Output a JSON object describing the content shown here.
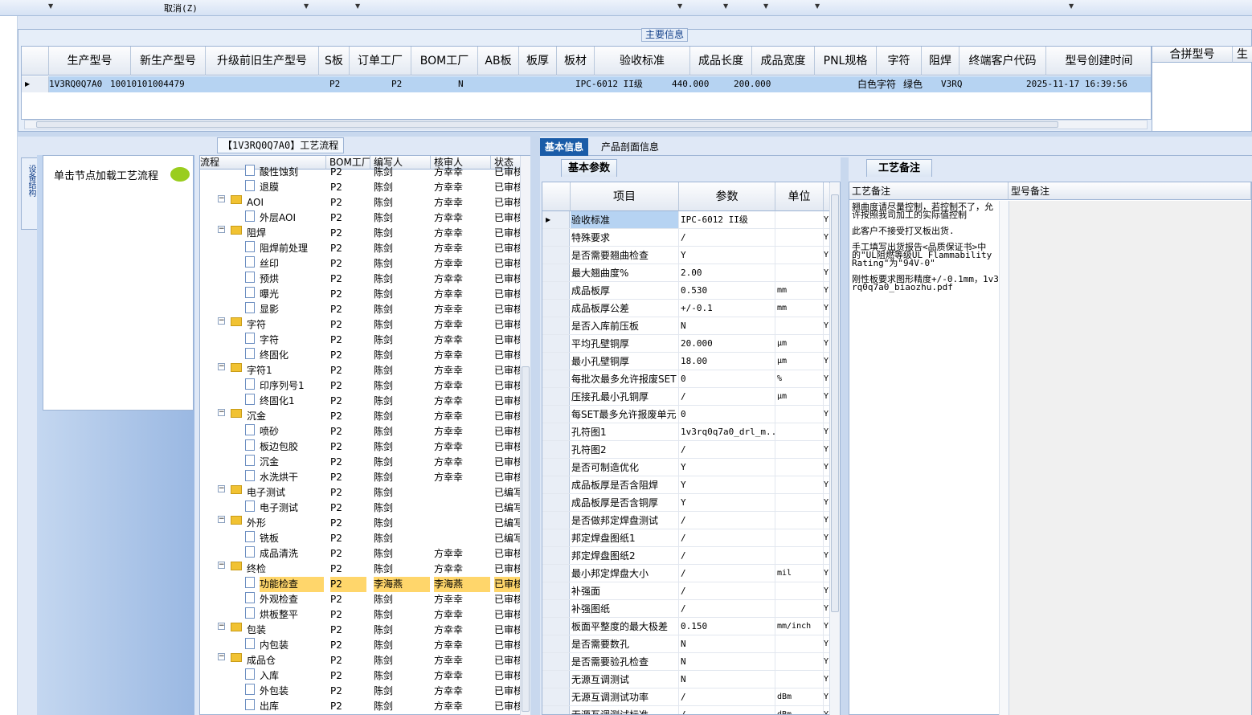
{
  "toolbar": {
    "cancel_label": "取消(Z)"
  },
  "main_info": {
    "legend": "主要信息",
    "columns": [
      "生产型号",
      "新生产型号",
      "升级前旧生产型号",
      "S板",
      "订单工厂",
      "BOM工厂",
      "AB板",
      "板厚",
      "板材",
      "验收标准",
      "成品长度",
      "成品宽度",
      "PNL规格",
      "字符",
      "阻焊",
      "终端客户代码",
      "型号创建时间"
    ],
    "row": {
      "prod_model": "1V3RQ0Q7A0",
      "new_prod_model": "10010101004479",
      "old_model": "",
      "s_board": "",
      "order_factory": "P2",
      "bom_factory": "P2",
      "ab_board": "N",
      "thickness": "",
      "material": "",
      "standard": "IPC-6012 II级",
      "length": "440.000",
      "width": "200.000",
      "pnl": "",
      "char": "白色字符",
      "mask": "绿色",
      "customer_code": "V3RQ",
      "created": "2025-11-17 16:39:56"
    },
    "merge_headers": [
      "合拼型号",
      "生"
    ]
  },
  "left_panel": {
    "side_tab": "设备结构",
    "load_hint": "单击节点加载工艺流程"
  },
  "process": {
    "tab_title": "【1V3RQ0Q7A0】工艺流程",
    "headers": [
      "流程",
      "BOM工厂",
      "编写人",
      "核审人",
      "状态"
    ],
    "rows": [
      {
        "lvl": 2,
        "type": "leaf",
        "name": "酸性蚀刻",
        "bom": "P2",
        "writer": "陈剑",
        "reviewer": "方幸幸",
        "status": "已审核"
      },
      {
        "lvl": 2,
        "type": "leaf",
        "name": "退膜",
        "bom": "P2",
        "writer": "陈剑",
        "reviewer": "方幸幸",
        "status": "已审核"
      },
      {
        "lvl": 1,
        "type": "folder",
        "name": "AOI",
        "bom": "P2",
        "writer": "陈剑",
        "reviewer": "方幸幸",
        "status": "已审核"
      },
      {
        "lvl": 2,
        "type": "leaf",
        "name": "外层AOI",
        "bom": "P2",
        "writer": "陈剑",
        "reviewer": "方幸幸",
        "status": "已审核"
      },
      {
        "lvl": 1,
        "type": "folder",
        "name": "阻焊",
        "bom": "P2",
        "writer": "陈剑",
        "reviewer": "方幸幸",
        "status": "已审核"
      },
      {
        "lvl": 2,
        "type": "leaf",
        "name": "阻焊前处理",
        "bom": "P2",
        "writer": "陈剑",
        "reviewer": "方幸幸",
        "status": "已审核"
      },
      {
        "lvl": 2,
        "type": "leaf",
        "name": "丝印",
        "bom": "P2",
        "writer": "陈剑",
        "reviewer": "方幸幸",
        "status": "已审核"
      },
      {
        "lvl": 2,
        "type": "leaf",
        "name": "预烘",
        "bom": "P2",
        "writer": "陈剑",
        "reviewer": "方幸幸",
        "status": "已审核"
      },
      {
        "lvl": 2,
        "type": "leaf",
        "name": "曝光",
        "bom": "P2",
        "writer": "陈剑",
        "reviewer": "方幸幸",
        "status": "已审核"
      },
      {
        "lvl": 2,
        "type": "leaf",
        "name": "显影",
        "bom": "P2",
        "writer": "陈剑",
        "reviewer": "方幸幸",
        "status": "已审核"
      },
      {
        "lvl": 1,
        "type": "folder",
        "name": "字符",
        "bom": "P2",
        "writer": "陈剑",
        "reviewer": "方幸幸",
        "status": "已审核"
      },
      {
        "lvl": 2,
        "type": "leaf",
        "name": "字符",
        "bom": "P2",
        "writer": "陈剑",
        "reviewer": "方幸幸",
        "status": "已审核"
      },
      {
        "lvl": 2,
        "type": "leaf",
        "name": "终固化",
        "bom": "P2",
        "writer": "陈剑",
        "reviewer": "方幸幸",
        "status": "已审核"
      },
      {
        "lvl": 1,
        "type": "folder",
        "name": "字符1",
        "bom": "P2",
        "writer": "陈剑",
        "reviewer": "方幸幸",
        "status": "已审核"
      },
      {
        "lvl": 2,
        "type": "leaf",
        "name": "印序列号1",
        "bom": "P2",
        "writer": "陈剑",
        "reviewer": "方幸幸",
        "status": "已审核"
      },
      {
        "lvl": 2,
        "type": "leaf",
        "name": "终固化1",
        "bom": "P2",
        "writer": "陈剑",
        "reviewer": "方幸幸",
        "status": "已审核"
      },
      {
        "lvl": 1,
        "type": "folder",
        "name": "沉金",
        "bom": "P2",
        "writer": "陈剑",
        "reviewer": "方幸幸",
        "status": "已审核"
      },
      {
        "lvl": 2,
        "type": "leaf",
        "name": "喷砂",
        "bom": "P2",
        "writer": "陈剑",
        "reviewer": "方幸幸",
        "status": "已审核"
      },
      {
        "lvl": 2,
        "type": "leaf",
        "name": "板边包胶",
        "bom": "P2",
        "writer": "陈剑",
        "reviewer": "方幸幸",
        "status": "已审核"
      },
      {
        "lvl": 2,
        "type": "leaf",
        "name": "沉金",
        "bom": "P2",
        "writer": "陈剑",
        "reviewer": "方幸幸",
        "status": "已审核"
      },
      {
        "lvl": 2,
        "type": "leaf",
        "name": "水洗烘干",
        "bom": "P2",
        "writer": "陈剑",
        "reviewer": "方幸幸",
        "status": "已审核"
      },
      {
        "lvl": 1,
        "type": "folder",
        "name": "电子测试",
        "bom": "P2",
        "writer": "陈剑",
        "reviewer": "",
        "status": "已编写"
      },
      {
        "lvl": 2,
        "type": "leaf",
        "name": "电子测试",
        "bom": "P2",
        "writer": "陈剑",
        "reviewer": "",
        "status": "已编写"
      },
      {
        "lvl": 1,
        "type": "folder",
        "name": "外形",
        "bom": "P2",
        "writer": "陈剑",
        "reviewer": "",
        "status": "已编写"
      },
      {
        "lvl": 2,
        "type": "leaf",
        "name": "铣板",
        "bom": "P2",
        "writer": "陈剑",
        "reviewer": "",
        "status": "已编写"
      },
      {
        "lvl": 2,
        "type": "leaf",
        "name": "成品清洗",
        "bom": "P2",
        "writer": "陈剑",
        "reviewer": "方幸幸",
        "status": "已审核"
      },
      {
        "lvl": 1,
        "type": "folder",
        "name": "终检",
        "bom": "P2",
        "writer": "陈剑",
        "reviewer": "方幸幸",
        "status": "已审核"
      },
      {
        "lvl": 2,
        "type": "leaf",
        "name": "功能检查",
        "bom": "P2",
        "writer": "李海燕",
        "reviewer": "李海燕",
        "status": "已审核",
        "selected": true
      },
      {
        "lvl": 2,
        "type": "leaf",
        "name": "外观检查",
        "bom": "P2",
        "writer": "陈剑",
        "reviewer": "方幸幸",
        "status": "已审核"
      },
      {
        "lvl": 2,
        "type": "leaf",
        "name": "烘板整平",
        "bom": "P2",
        "writer": "陈剑",
        "reviewer": "方幸幸",
        "status": "已审核"
      },
      {
        "lvl": 1,
        "type": "folder",
        "name": "包装",
        "bom": "P2",
        "writer": "陈剑",
        "reviewer": "方幸幸",
        "status": "已审核"
      },
      {
        "lvl": 2,
        "type": "leaf",
        "name": "内包装",
        "bom": "P2",
        "writer": "陈剑",
        "reviewer": "方幸幸",
        "status": "已审核"
      },
      {
        "lvl": 1,
        "type": "folder",
        "name": "成品仓",
        "bom": "P2",
        "writer": "陈剑",
        "reviewer": "方幸幸",
        "status": "已审核"
      },
      {
        "lvl": 2,
        "type": "leaf",
        "name": "入库",
        "bom": "P2",
        "writer": "陈剑",
        "reviewer": "方幸幸",
        "status": "已审核"
      },
      {
        "lvl": 2,
        "type": "leaf",
        "name": "外包装",
        "bom": "P2",
        "writer": "陈剑",
        "reviewer": "方幸幸",
        "status": "已审核"
      },
      {
        "lvl": 2,
        "type": "leaf",
        "name": "出库",
        "bom": "P2",
        "writer": "陈剑",
        "reviewer": "方幸幸",
        "status": "已审核"
      }
    ]
  },
  "right_tabs": [
    "基本信息",
    "产品剖面信息"
  ],
  "basic": {
    "tab": "基本参数",
    "headers": [
      "项目",
      "参数",
      "单位"
    ],
    "rows": [
      [
        "验收标准",
        "IPC-6012 II级",
        "",
        "Y"
      ],
      [
        "特殊要求",
        "/",
        "",
        "Y"
      ],
      [
        "是否需要翘曲检查",
        "Y",
        "",
        "Y"
      ],
      [
        "最大翘曲度%",
        "2.00",
        "",
        "Y"
      ],
      [
        "成品板厚",
        "0.530",
        "mm",
        "Y"
      ],
      [
        "成品板厚公差",
        "+/-0.1",
        "mm",
        "Y"
      ],
      [
        "是否入库前压板",
        "N",
        "",
        "Y"
      ],
      [
        "平均孔壁铜厚",
        "20.000",
        "μm",
        "Y"
      ],
      [
        "最小孔壁铜厚",
        "18.00",
        "μm",
        "Y"
      ],
      [
        "每批次最多允许报废SET",
        "0",
        "%",
        "Y"
      ],
      [
        "压接孔最小孔铜厚",
        "/",
        "μm",
        "Y"
      ],
      [
        "每SET最多允许报废单元",
        "0",
        "",
        "Y"
      ],
      [
        "孔符图1",
        "1v3rq0q7a0_drl_m...",
        "",
        "Y"
      ],
      [
        "孔符图2",
        "/",
        "",
        "Y"
      ],
      [
        "是否可制造优化",
        "Y",
        "",
        "Y"
      ],
      [
        "成品板厚是否含阻焊",
        "Y",
        "",
        "Y"
      ],
      [
        "成品板厚是否含铜厚",
        "Y",
        "",
        "Y"
      ],
      [
        "是否做邦定焊盘测试",
        "/",
        "",
        "Y"
      ],
      [
        "邦定焊盘图纸1",
        "/",
        "",
        "Y"
      ],
      [
        "邦定焊盘图纸2",
        "/",
        "",
        "Y"
      ],
      [
        "最小邦定焊盘大小",
        "/",
        "mil",
        "Y"
      ],
      [
        "补强面",
        "/",
        "",
        "Y"
      ],
      [
        "补强图纸",
        "/",
        "",
        "Y"
      ],
      [
        "板面平整度的最大极差",
        "0.150",
        "mm/inch",
        "Y"
      ],
      [
        "是否需要数孔",
        "N",
        "",
        "Y"
      ],
      [
        "是否需要验孔检查",
        "N",
        "",
        "Y"
      ],
      [
        "无源互调测试",
        "N",
        "",
        "Y"
      ],
      [
        "无源互调测试功率",
        "/",
        "dBm",
        "Y"
      ],
      [
        "无源互调测试标准",
        "/",
        "dBm",
        "Y"
      ]
    ]
  },
  "memo": {
    "tab": "工艺备注",
    "headers": [
      "工艺备注",
      "型号备注"
    ],
    "text": "翘曲度请尽量控制，若控制不了，允许按照我司加工的实际值控制\n\n此客户不接受打叉板出货.\n\n手工填写出货报告<品质保证书>中的\"UL阻燃等级UL Flammability Rating\"为\"94V-0\"\n\n刚性板要求图形精度+/-0.1mm，1v3rq0q7a0_biaozhu.pdf"
  }
}
